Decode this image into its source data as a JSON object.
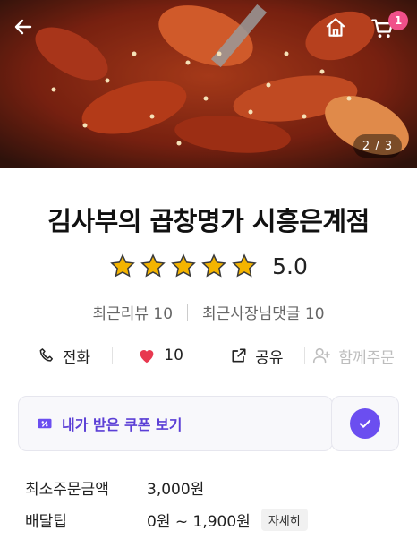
{
  "hero": {
    "page_indicator": "2 / 3",
    "cart_badge": "1",
    "icons": [
      "back-arrow-icon",
      "home-icon",
      "cart-icon"
    ]
  },
  "store": {
    "name": "김사부의 곱창명가 시흥은계점",
    "rating": "5.0",
    "stars_filled": 5,
    "recent_reviews": "최근리뷰 10",
    "owner_comments": "최근사장님댓글 10"
  },
  "actions": {
    "call": "전화",
    "like_count": "10",
    "share": "공유",
    "group_order": "함께주문"
  },
  "coupon": {
    "label": "내가 받은 쿠폰 보기"
  },
  "info": {
    "min_order_label": "최소주문금액",
    "min_order_value": "3,000원",
    "delivery_tip_label": "배달팁",
    "delivery_tip_value": "0원 ~ 1,900원",
    "detail_button": "자세히"
  },
  "colors": {
    "accent": "#6b4ef0",
    "star": "#f4b400",
    "heart": "#e8384f",
    "badge": "#f0508a"
  }
}
